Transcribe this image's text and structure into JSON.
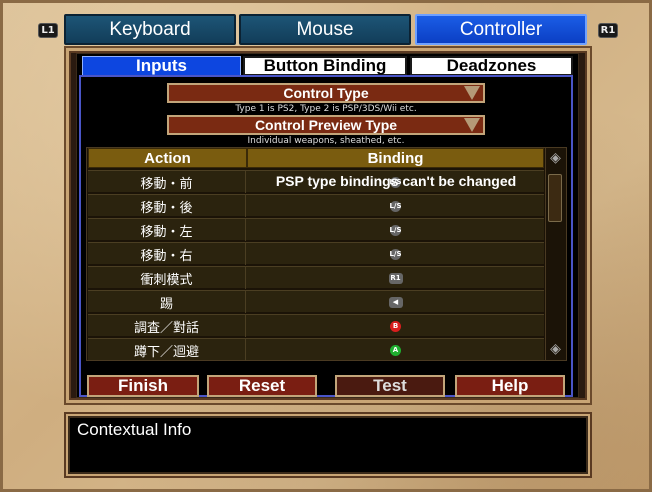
{
  "shoulders": {
    "left": "L1",
    "right": "R1"
  },
  "top_tabs": [
    {
      "label": "Keyboard",
      "active": false
    },
    {
      "label": "Mouse",
      "active": false
    },
    {
      "label": "Controller",
      "active": true
    }
  ],
  "sub_tabs": [
    {
      "label": "Inputs",
      "active": true
    },
    {
      "label": "Button Binding",
      "active": false
    },
    {
      "label": "Deadzones",
      "active": false
    }
  ],
  "control_type": {
    "label": "Control Type",
    "hint": "Type 1 is PS2, Type 2 is PSP/3DS/Wii etc."
  },
  "preview_type": {
    "label": "Control Preview Type",
    "hint": "Individual weapons, sheathed, etc."
  },
  "table": {
    "headers": {
      "action": "Action",
      "binding": "Binding"
    },
    "notice": "PSP type bindings can't be changed",
    "rows": [
      {
        "action": "移動・前",
        "glyph": "L/S"
      },
      {
        "action": "移動・後",
        "glyph": "L/S"
      },
      {
        "action": "移動・左",
        "glyph": "L/S"
      },
      {
        "action": "移動・右",
        "glyph": "L/S"
      },
      {
        "action": "衝刺模式",
        "glyph": "R1"
      },
      {
        "action": "踢",
        "glyph": "◀"
      },
      {
        "action": "調査／對話",
        "glyph": "B"
      },
      {
        "action": "蹲下／迴避",
        "glyph": "A"
      }
    ],
    "scroll_up_icon": "◈",
    "scroll_down_icon": "◈"
  },
  "buttons": {
    "finish": "Finish",
    "reset": "Reset",
    "test": "Test",
    "help": "Help"
  },
  "contextual_info": {
    "title": "Contextual Info"
  },
  "colors": {
    "active_tab": "#0b3fc4",
    "inactive_tab": "#123d59",
    "dropdown_bg": "#7a2a12",
    "header_bg": "#7a5c0f"
  }
}
